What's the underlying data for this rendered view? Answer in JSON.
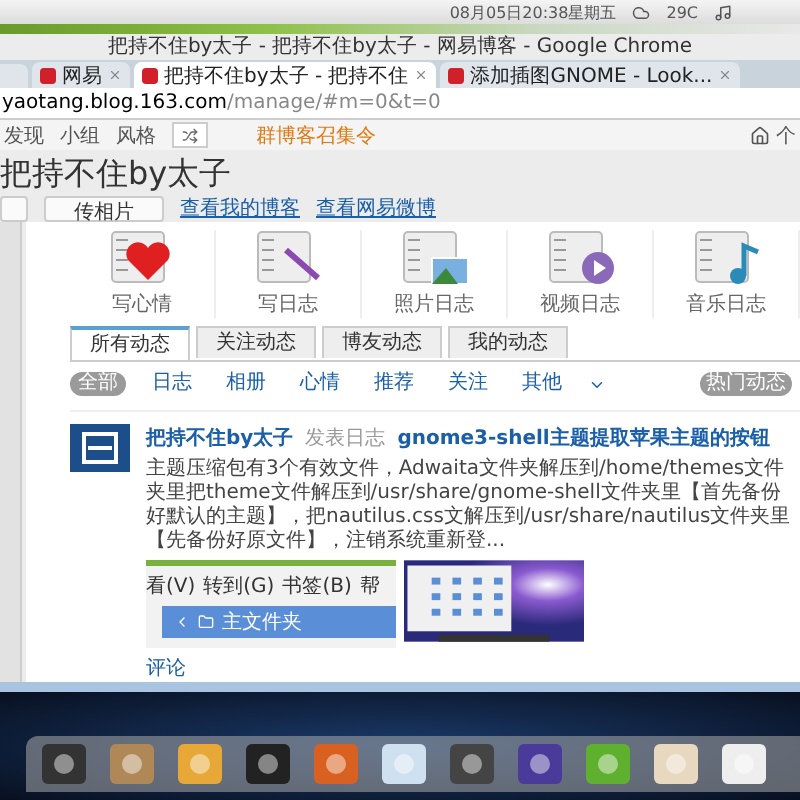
{
  "top_panel": {
    "clock": "08月05日20:38星期五",
    "temperature": "29C"
  },
  "browser": {
    "title": "把持不住by太子 - 把持不住by太子 - 网易博客 - Google Chrome",
    "tabs": [
      {
        "label": "网易",
        "selected": false
      },
      {
        "label": "把持不住by太子 - 把持不住",
        "selected": true
      },
      {
        "label": "添加插图GNOME - Look...",
        "selected": false
      }
    ],
    "address": {
      "host": "yaotang.blog.163.com",
      "path": "/manage/#m=0&t=0"
    }
  },
  "nav": {
    "links": [
      "发现",
      "小组",
      "风格"
    ],
    "promo": "群博客召集令",
    "account": "个"
  },
  "blog": {
    "title": "把持不住by太子",
    "buttons": [
      "传相片"
    ],
    "links": [
      "查看我的博客",
      "查看网易微博"
    ]
  },
  "actions": [
    {
      "kind": "mood",
      "label": "写心情"
    },
    {
      "kind": "diary",
      "label": "写日志"
    },
    {
      "kind": "photo",
      "label": "照片日志"
    },
    {
      "kind": "video",
      "label": "视频日志"
    },
    {
      "kind": "music",
      "label": "音乐日志"
    }
  ],
  "feed_tabs": [
    {
      "label": "所有动态",
      "selected": true
    },
    {
      "label": "关注动态",
      "selected": false
    },
    {
      "label": "博友动态",
      "selected": false
    },
    {
      "label": "我的动态",
      "selected": false
    }
  ],
  "filters": [
    {
      "label": "全部",
      "selected": true
    },
    {
      "label": "日志",
      "selected": false
    },
    {
      "label": "相册",
      "selected": false
    },
    {
      "label": "心情",
      "selected": false
    },
    {
      "label": "推荐",
      "selected": false
    },
    {
      "label": "关注",
      "selected": false
    },
    {
      "label": "其他",
      "selected": false
    }
  ],
  "hot": "热门动态",
  "post": {
    "author": "把持不住by太子",
    "action": "发表日志",
    "title": "gnome3-shell主题提取苹果主题的按钮",
    "body": "主题压缩包有3个有效文件，Adwaita文件夹解压到/home/themes文件夹里把theme文件解压到/usr/share/gnome-shell文件夹里【首先备份好默认的主题】，把nautilus.css文解压到/usr/share/nautilus文件夹里【先备份好原文件】，注销系统重新登...",
    "thumbnail": {
      "menu": [
        "看(V)",
        "转到(G)",
        "书签(B)",
        "帮"
      ],
      "location": "主文件夹"
    },
    "comment_link": "评论"
  }
}
